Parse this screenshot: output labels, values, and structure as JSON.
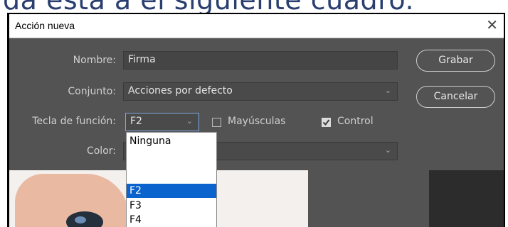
{
  "caption": "da esta a el siguiente cuadro.",
  "window": {
    "title": "Acción nueva",
    "close_glyph": "✕"
  },
  "form": {
    "name_label": "Nombre:",
    "name_value": "Firma",
    "set_label": "Conjunto:",
    "set_value": "Acciones por defecto",
    "fkey_label": "Tecla de función:",
    "fkey_value": "F2",
    "shift_label": "Mayúsculas",
    "shift_checked": false,
    "control_label": "Control",
    "control_checked": true,
    "color_label": "Color:",
    "color_value": ""
  },
  "buttons": {
    "record": "Grabar",
    "cancel": "Cancelar"
  },
  "fkey_options": [
    "Ninguna",
    "",
    "F2",
    "F3",
    "F4"
  ],
  "fkey_selected": "F2",
  "icons": {
    "chevron": "chevron-down-icon",
    "check": "check-icon",
    "close": "close-icon"
  },
  "colors": {
    "dialog_bg": "#535353",
    "field_bg": "#454545",
    "selection": "#0b63ce"
  }
}
